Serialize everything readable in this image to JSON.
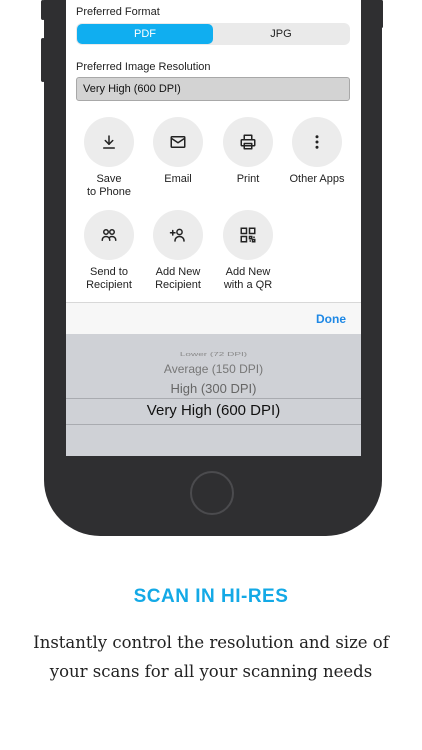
{
  "settings": {
    "format_label": "Preferred Format",
    "format_options": [
      "PDF",
      "JPG"
    ],
    "format_selected": "PDF",
    "resolution_label": "Preferred Image Resolution",
    "resolution_value": "Very High (600 DPI)"
  },
  "actions": [
    {
      "label": "Save\nto Phone",
      "icon": "download-icon"
    },
    {
      "label": "Email",
      "icon": "mail-icon"
    },
    {
      "label": "Print",
      "icon": "printer-icon"
    },
    {
      "label": "Other Apps",
      "icon": "more-vertical-icon"
    },
    {
      "label": "Send to\nRecipient",
      "icon": "people-icon"
    },
    {
      "label": "Add New\nRecipient",
      "icon": "add-person-icon"
    },
    {
      "label": "Add New\nwith a QR",
      "icon": "qr-code-icon"
    }
  ],
  "picker": {
    "done_label": "Done",
    "options": [
      "Lower (72 DPI)",
      "Average (150 DPI)",
      "High (300 DPI)",
      "Very High (600 DPI)"
    ],
    "selected": "Very High (600 DPI)"
  },
  "marketing": {
    "headline": "SCAN IN HI-RES",
    "description": "Instantly control the resolution and size of your scans for all your scanning needs"
  },
  "colors": {
    "accent": "#13a9e6",
    "segment_active": "#10aef0",
    "done": "#1e88e5",
    "phone": "#2f2f31"
  }
}
